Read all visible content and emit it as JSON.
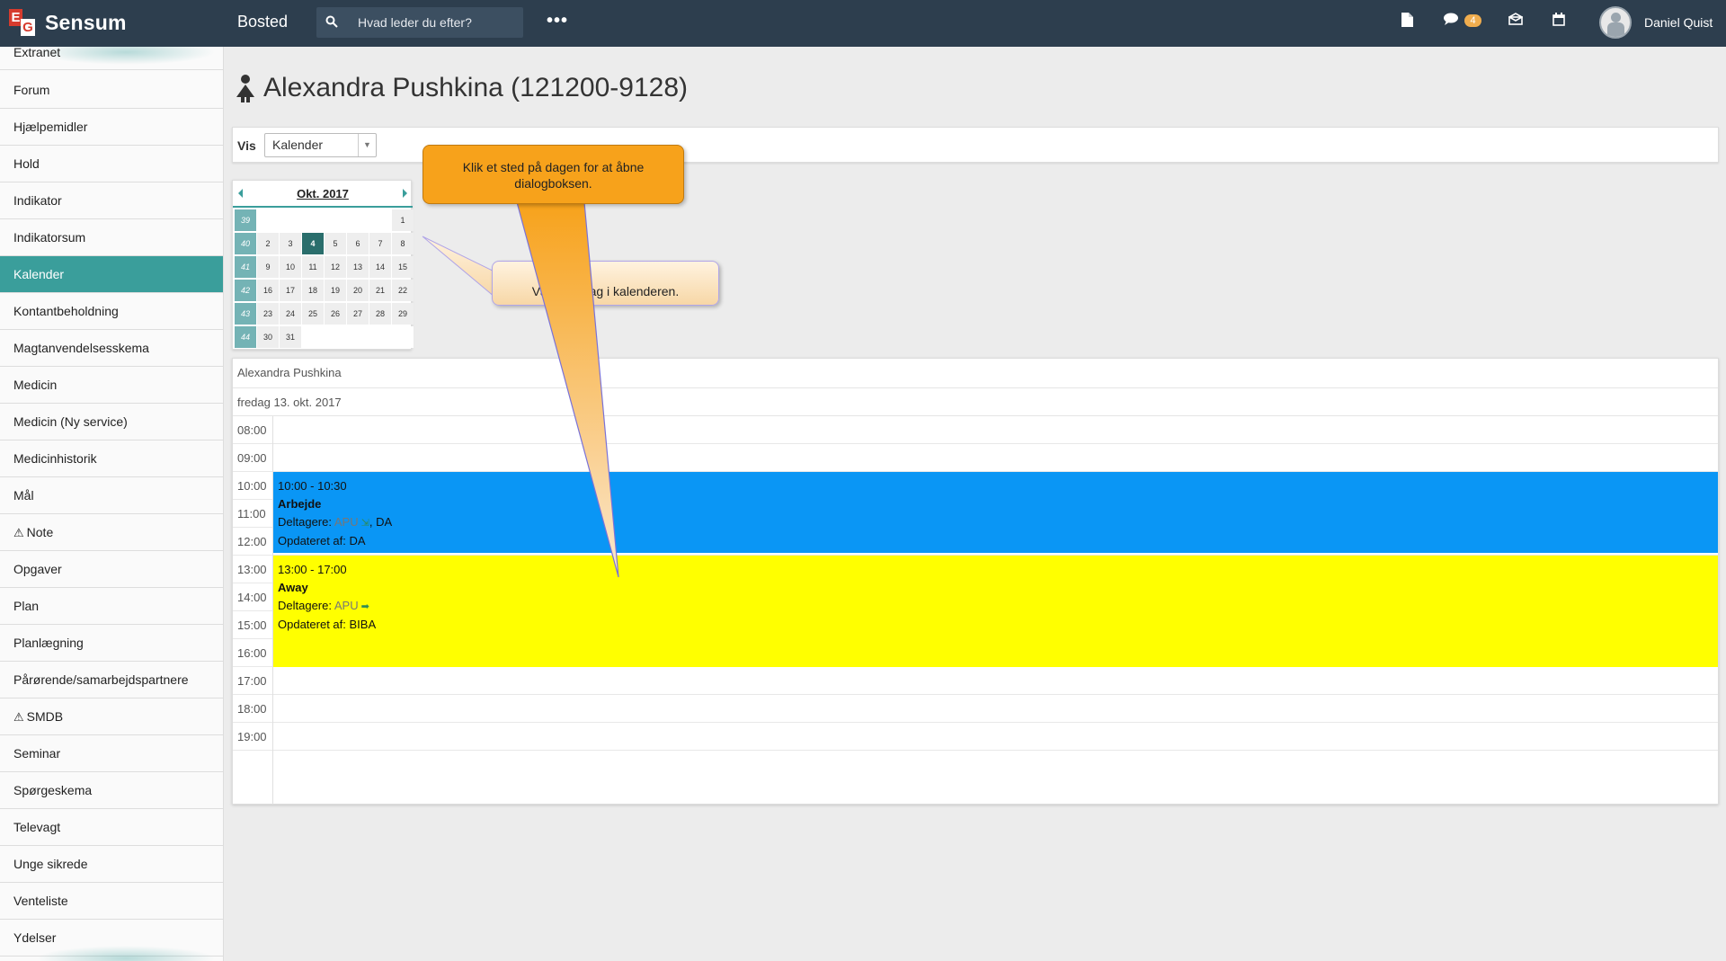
{
  "topbar": {
    "brand": "Sensum",
    "logo_letters": [
      "E",
      "G"
    ],
    "section": "Bosted",
    "search_placeholder": "Hvad leder du efter?",
    "more_label": "•••",
    "message_count": "4",
    "user_name": "Daniel Quist",
    "icons": [
      "search-icon",
      "more-icon",
      "document-icon",
      "chat-icon",
      "envelope-icon",
      "calendar-icon",
      "avatar"
    ]
  },
  "sidebar": {
    "items": [
      {
        "label": "Extranet",
        "warning": false,
        "active": false
      },
      {
        "label": "Forum",
        "warning": false,
        "active": false
      },
      {
        "label": "Hjælpemidler",
        "warning": false,
        "active": false
      },
      {
        "label": "Hold",
        "warning": false,
        "active": false
      },
      {
        "label": "Indikator",
        "warning": false,
        "active": false
      },
      {
        "label": "Indikatorsum",
        "warning": false,
        "active": false
      },
      {
        "label": "Kalender",
        "warning": false,
        "active": true
      },
      {
        "label": "Kontantbeholdning",
        "warning": false,
        "active": false
      },
      {
        "label": "Magtanvendelsesskema",
        "warning": false,
        "active": false
      },
      {
        "label": "Medicin",
        "warning": false,
        "active": false
      },
      {
        "label": "Medicin (Ny service)",
        "warning": false,
        "active": false
      },
      {
        "label": "Medicinhistorik",
        "warning": false,
        "active": false
      },
      {
        "label": "Mål",
        "warning": false,
        "active": false
      },
      {
        "label": "Note",
        "warning": true,
        "active": false
      },
      {
        "label": "Opgaver",
        "warning": false,
        "active": false
      },
      {
        "label": "Plan",
        "warning": false,
        "active": false
      },
      {
        "label": "Planlægning",
        "warning": false,
        "active": false
      },
      {
        "label": "Pårørende/samarbejdspartnere",
        "warning": false,
        "active": false
      },
      {
        "label": "SMDB",
        "warning": true,
        "active": false
      },
      {
        "label": "Seminar",
        "warning": false,
        "active": false
      },
      {
        "label": "Spørgeskema",
        "warning": false,
        "active": false
      },
      {
        "label": "Televagt",
        "warning": false,
        "active": false
      },
      {
        "label": "Unge sikrede",
        "warning": false,
        "active": false
      },
      {
        "label": "Venteliste",
        "warning": false,
        "active": false
      },
      {
        "label": "Ydelser",
        "warning": false,
        "active": false
      }
    ]
  },
  "main": {
    "title": "Alexandra Pushkina (121200-9128)",
    "view_label": "Vis",
    "view_value": "Kalender",
    "minical": {
      "title": "Okt. 2017",
      "weeks": [
        {
          "week": "39",
          "days": [
            "",
            "",
            "",
            "",
            "",
            "",
            "1"
          ]
        },
        {
          "week": "40",
          "days": [
            "2",
            "3",
            "4",
            "5",
            "6",
            "7",
            "8"
          ]
        },
        {
          "week": "41",
          "days": [
            "9",
            "10",
            "11",
            "12",
            "13",
            "14",
            "15"
          ]
        },
        {
          "week": "42",
          "days": [
            "16",
            "17",
            "18",
            "19",
            "20",
            "21",
            "22"
          ]
        },
        {
          "week": "43",
          "days": [
            "23",
            "24",
            "25",
            "26",
            "27",
            "28",
            "29"
          ]
        },
        {
          "week": "44",
          "days": [
            "30",
            "31",
            "",
            "",
            "",
            "",
            ""
          ]
        }
      ],
      "today": "4"
    },
    "dayview": {
      "person": "Alexandra Pushkina",
      "date": "fredag 13. okt. 2017",
      "hours": [
        "08:00",
        "09:00",
        "10:00",
        "11:00",
        "12:00",
        "13:00",
        "14:00",
        "15:00",
        "16:00",
        "17:00",
        "18:00",
        "19:00"
      ],
      "events": [
        {
          "time": "10:00 - 10:30",
          "title": "Arbejde",
          "participants_label": "Deltagere:",
          "participants": [
            "APU",
            "DA"
          ],
          "updated": "Opdateret af: DA",
          "color": "#0a96f5"
        },
        {
          "time": "13:00 - 17:00",
          "title": "Away",
          "participants_label": "Deltagere:",
          "participants": [
            "APU"
          ],
          "updated": "Opdateret af: BIBA",
          "color": "#ffff00"
        }
      ]
    }
  },
  "tooltips": {
    "select_day": "Vælg en dag i kalenderen.",
    "click_day": "Klik et sted på dagen for at åbne dialogboksen."
  },
  "colors": {
    "topbar": "#2d3e4e",
    "accent": "#3a9e9b",
    "tooltip_orange": "#f7a21b"
  }
}
